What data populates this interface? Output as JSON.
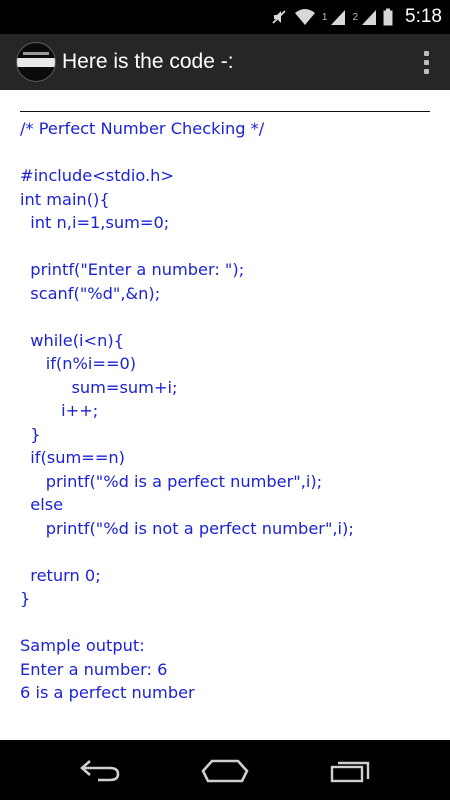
{
  "status_bar": {
    "time": "5:18",
    "sim1_label": "1",
    "sim2_label": "2",
    "icons": [
      "mute-icon",
      "wifi-icon",
      "signal-icon",
      "signal-icon",
      "battery-icon"
    ]
  },
  "action_bar": {
    "title": "Here is the code -:",
    "logo_icon": "app-logo",
    "overflow_icon": "overflow-menu-icon"
  },
  "code_lines": [
    "/* Perfect Number Checking */",
    "",
    "#include<stdio.h>",
    "int main(){",
    "  int n,i=1,sum=0;",
    "",
    "  printf(\"Enter a number: \");",
    "  scanf(\"%d\",&n);",
    "",
    "  while(i<n){",
    "     if(n%i==0)",
    "          sum=sum+i;",
    "        i++;",
    "  }",
    "  if(sum==n)",
    "     printf(\"%d is a perfect number\",i);",
    "  else",
    "     printf(\"%d is not a perfect number\",i);",
    "",
    "  return 0;",
    "}",
    "",
    "Sample output:",
    "Enter a number: 6",
    "6 is a perfect number"
  ],
  "nav_bar": {
    "back_icon": "back-icon",
    "home_icon": "home-icon",
    "recents_icon": "recents-icon"
  },
  "colors": {
    "code_text": "#1c23d4",
    "action_bar": "#262626",
    "system_bars": "#000000"
  }
}
